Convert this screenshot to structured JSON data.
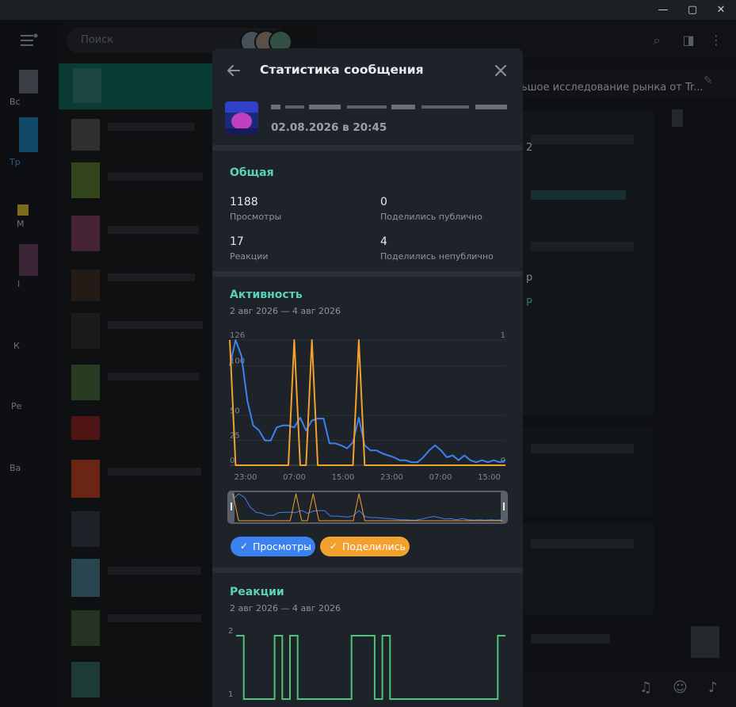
{
  "window": {
    "controls": {
      "minimize": "—",
      "maximize": "▢",
      "close": "✕"
    }
  },
  "sidebar": {
    "folders": [
      {
        "label": "Вс"
      },
      {
        "label": "Тр"
      },
      {
        "label": "M"
      },
      {
        "label": "I"
      },
      {
        "label": "К"
      },
      {
        "label": "Ре"
      },
      {
        "label": "Ва"
      }
    ]
  },
  "search": {
    "placeholder": "Поиск"
  },
  "chat": {
    "pinned_text": "ьшое исследование рынка от Tr...",
    "fragments": [
      "2",
      "р",
      "Р"
    ]
  },
  "modal": {
    "title": "Статистика сообщения",
    "message_date": "02.08.2026 в 20:45",
    "overview": {
      "title": "Общая",
      "stats": [
        {
          "value": "1188",
          "label": "Просмотры"
        },
        {
          "value": "0",
          "label": "Поделились публично"
        },
        {
          "value": "17",
          "label": "Реакции"
        },
        {
          "value": "4",
          "label": "Поделились непублично"
        }
      ]
    },
    "activity": {
      "title": "Активность",
      "range": "2 авг 2026 — 4 авг 2026",
      "chips": [
        {
          "label": "Просмотры",
          "color": "#3b82f0"
        },
        {
          "label": "Поделились",
          "color": "#f2a12e"
        }
      ]
    },
    "reactions": {
      "title": "Реакции",
      "range": "2 авг 2026 — 4 авг 2026"
    }
  },
  "chart_data": [
    {
      "type": "line",
      "categories": [
        "23:00",
        "07:00",
        "15:00",
        "23:00",
        "07:00",
        "15:00"
      ],
      "y_left_ticks": [
        0,
        25,
        50,
        100,
        126
      ],
      "y_right_ticks": [
        0,
        1
      ],
      "ylim_left": [
        0,
        126
      ],
      "ylim_right": [
        0,
        1
      ],
      "grid": true,
      "series": [
        {
          "name": "Просмотры",
          "color": "#3b82f0",
          "axis": "left",
          "values": [
            100,
            126,
            110,
            65,
            40,
            35,
            25,
            25,
            38,
            40,
            40,
            38,
            48,
            35,
            45,
            47,
            47,
            22,
            22,
            20,
            17,
            23,
            48,
            20,
            15,
            15,
            12,
            10,
            8,
            5,
            5,
            3,
            3,
            8,
            15,
            20,
            15,
            8,
            10,
            5,
            10,
            5,
            3,
            5,
            3,
            5,
            3,
            5
          ]
        },
        {
          "name": "Поделились",
          "color": "#f2a12e",
          "axis": "right",
          "values": [
            1,
            0,
            0,
            0,
            0,
            0,
            0,
            0,
            0,
            0,
            0,
            1,
            0,
            0,
            1,
            0,
            0,
            0,
            0,
            0,
            0,
            0,
            1,
            0,
            0,
            0,
            0,
            0,
            0,
            0,
            0,
            0,
            0,
            0,
            0,
            0,
            0,
            0,
            0,
            0,
            0,
            0,
            0,
            0,
            0,
            0,
            0,
            0
          ]
        }
      ]
    },
    {
      "type": "line",
      "y_ticks": [
        1,
        2
      ],
      "ylim": [
        1,
        2
      ],
      "grid": false,
      "series": [
        {
          "color": "#4fc37a",
          "values": [
            2,
            1,
            1,
            1,
            1,
            2,
            1,
            2,
            1,
            1,
            1,
            1,
            1,
            1,
            1,
            2,
            2,
            2,
            1,
            2,
            1,
            1,
            1,
            1,
            1,
            1,
            1,
            1,
            1,
            1,
            1,
            1,
            1,
            1,
            2,
            2
          ]
        }
      ]
    }
  ]
}
